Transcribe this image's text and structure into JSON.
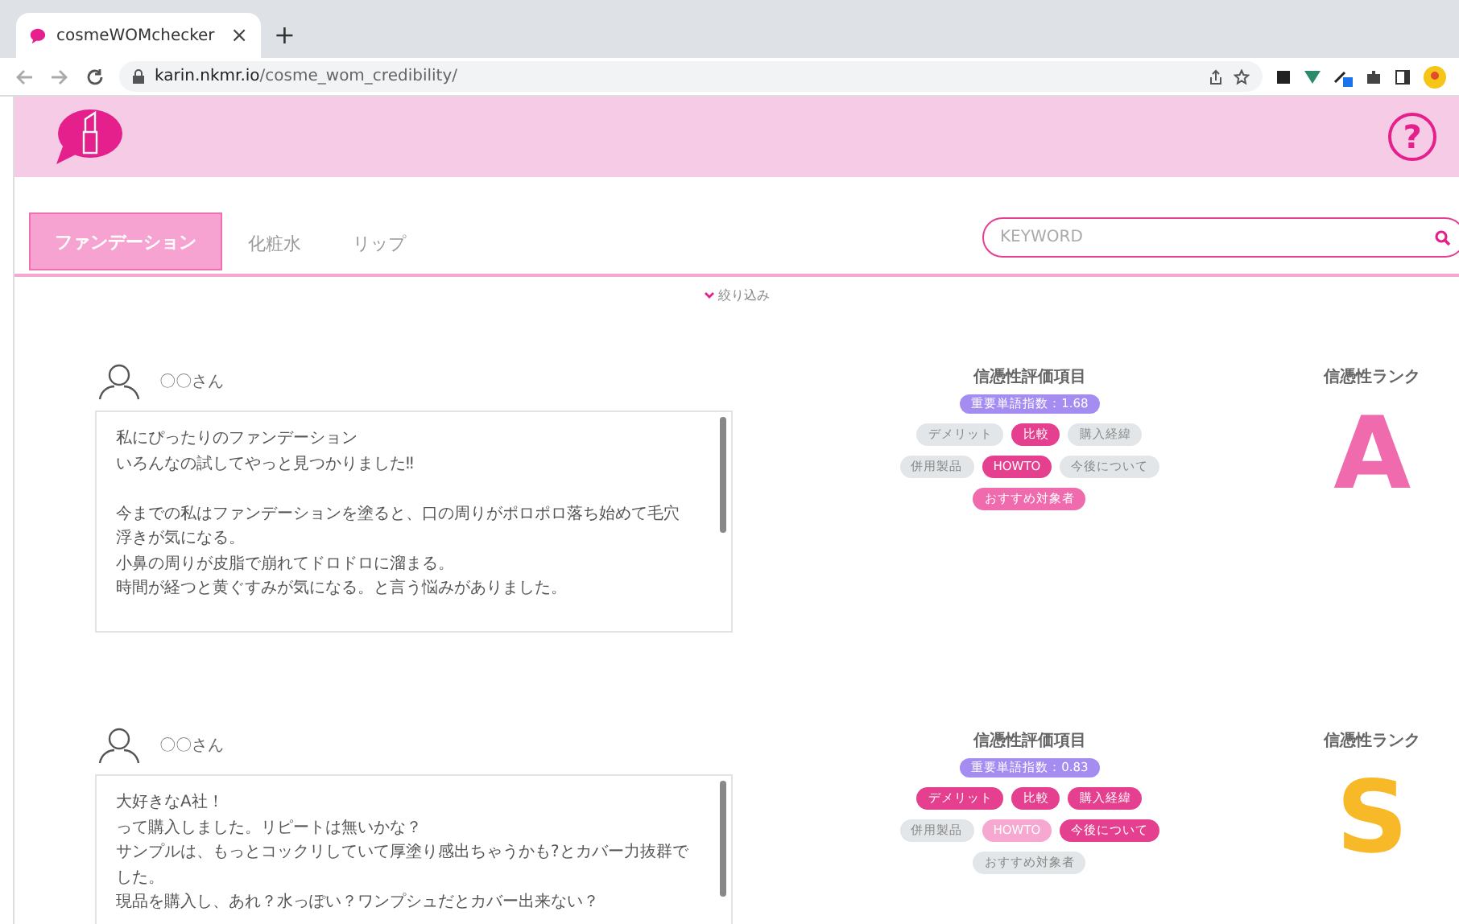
{
  "browser": {
    "tab_title": "cosmeWOMchecker",
    "tab_close": "×",
    "new_tab": "+",
    "url_host": "karin.nkmr.io",
    "url_path": "/cosme_wom_credibility/"
  },
  "header": {
    "help": "?"
  },
  "tabs": [
    {
      "label": "ファンデーション",
      "selected": true
    },
    {
      "label": "化粧水",
      "selected": false
    },
    {
      "label": "リップ",
      "selected": false
    }
  ],
  "search": {
    "placeholder": "KEYWORD"
  },
  "filter": {
    "label": "絞り込み"
  },
  "reviews": [
    {
      "user": "〇〇さん",
      "paragraphs": [
        [
          "私にぴったりのファンデーション",
          "いろんなの試してやっと見つかりました‼"
        ],
        [
          "今までの私はファンデーションを塗ると、口の周りがポロポロ落ち始めて毛穴浮きが気になる。",
          "小鼻の周りが皮脂で崩れてドロドロに溜まる。",
          "時間が経つと黄ぐすみが気になる。と言う悩みがありました。"
        ]
      ],
      "criteria_title": "信憑性評価項目",
      "score": "重要単語指数：1.68",
      "tag_rows": [
        [
          {
            "label": "デメリット",
            "color": "#e3e6e8"
          },
          {
            "label": "比較",
            "color": "#e5408f"
          },
          {
            "label": "購入経緯",
            "color": "#e3e6e8"
          }
        ],
        [
          {
            "label": "併用製品",
            "color": "#e3e6e8"
          },
          {
            "label": "HOWTO",
            "color": "#e5408f"
          },
          {
            "label": "今後について",
            "color": "#e3e6e8"
          }
        ],
        [
          {
            "label": "おすすめ対象者",
            "color": "#f06aae"
          }
        ]
      ],
      "rank_title": "信憑性ランク",
      "rank": "A",
      "color": "#f06aae"
    },
    {
      "user": "〇〇さん",
      "paragraphs": [
        [
          "大好きなA社！",
          "って購入しました。リピートは無いかな？",
          "サンプルは、もっとコックリしていて厚塗り感出ちゃうかも?とカバー力抜群でした。",
          "現品を購入し、あれ？水っぽい？ワンプシュだとカバー出来ない？"
        ]
      ],
      "criteria_title": "信憑性評価項目",
      "score": "重要単語指数：0.83",
      "tag_rows": [
        [
          {
            "label": "デメリット",
            "color": "#e5408f"
          },
          {
            "label": "比較",
            "color": "#e5408f"
          },
          {
            "label": "購入経緯",
            "color": "#e5408f"
          }
        ],
        [
          {
            "label": "併用製品",
            "color": "#e3e6e8"
          },
          {
            "label": "HOWTO",
            "color": "#f6a8d0"
          },
          {
            "label": "今後について",
            "color": "#e5408f"
          }
        ],
        [
          {
            "label": "おすすめ対象者",
            "color": "#e3e6e8"
          }
        ]
      ],
      "rank_title": "信憑性ランク",
      "rank": "S",
      "color": "#f7b928"
    }
  ]
}
